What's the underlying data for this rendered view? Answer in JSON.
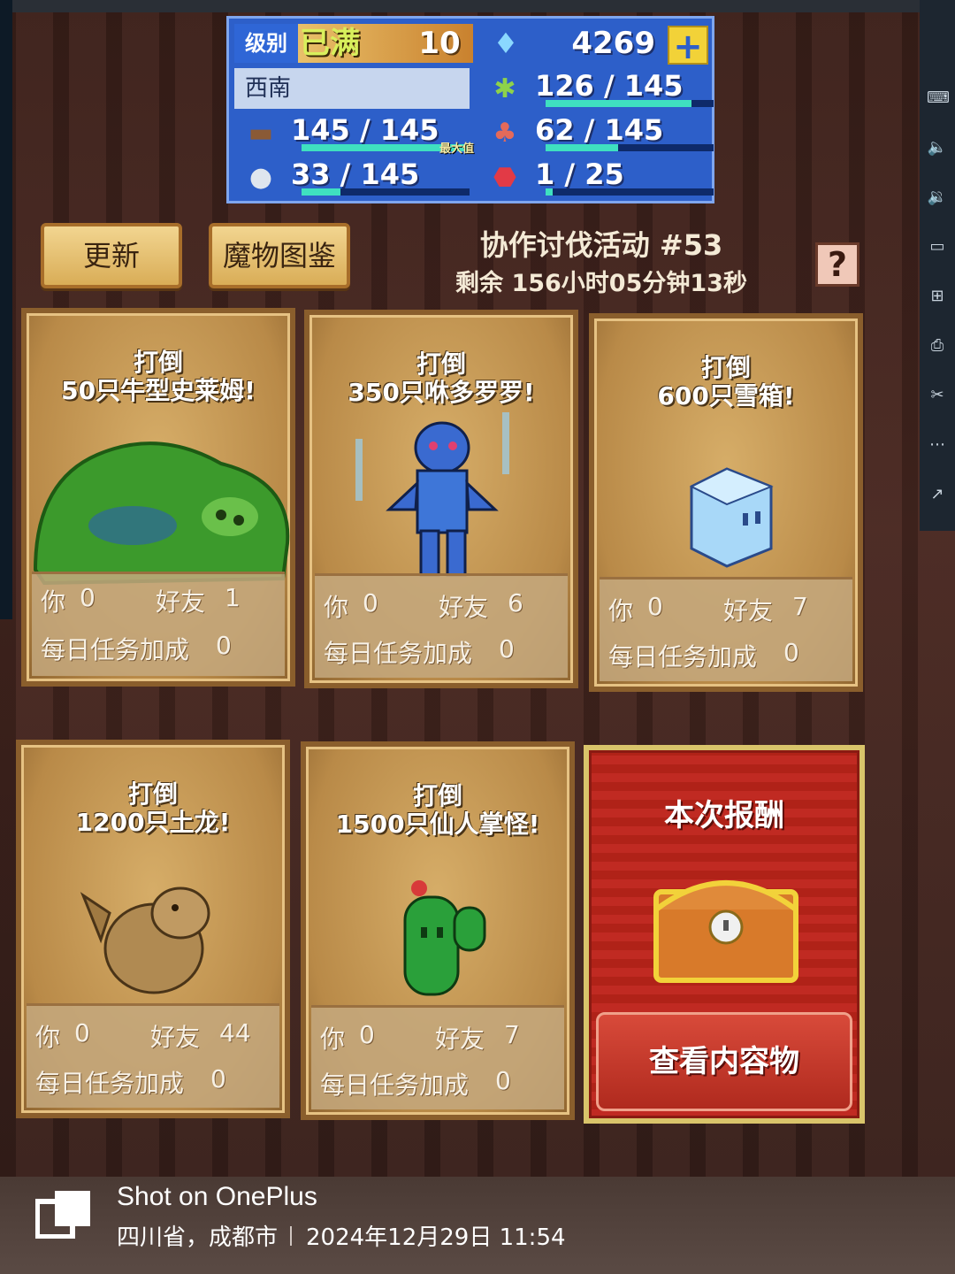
{
  "hud": {
    "level_label": "级别",
    "level_status": "已满",
    "level": "10",
    "gems": "4269",
    "plus": "+",
    "region": "西南",
    "max_tag": "最大值",
    "resources": [
      {
        "icon": "wood-log-icon",
        "value": "145",
        "max": "145",
        "fill": 1.0
      },
      {
        "icon": "stone-icon",
        "value": "33",
        "max": "145",
        "fill": 0.23
      },
      {
        "icon": "grass-food-icon",
        "value": "126",
        "max": "145",
        "fill": 0.87
      },
      {
        "icon": "meat-icon",
        "value": "62",
        "max": "145",
        "fill": 0.43
      },
      {
        "icon": "red-crystal-icon",
        "value": "1",
        "max": "25",
        "fill": 0.04
      }
    ]
  },
  "buttons": {
    "refresh": "更新",
    "monster_guide": "魔物图鉴",
    "help": "?"
  },
  "event": {
    "title": "协作讨伐活动 #53",
    "timer": "剩余 156小时05分钟13秒"
  },
  "stat_labels": {
    "you": "你",
    "friends": "好友",
    "daily_bonus": "每日任务加成"
  },
  "cards": [
    {
      "line1": "打倒",
      "line2": "50只牛型史莱姆!",
      "you": "0",
      "friends": "1",
      "bonus": "0"
    },
    {
      "line1": "打倒",
      "line2": "350只咻多罗罗!",
      "you": "0",
      "friends": "6",
      "bonus": "0"
    },
    {
      "line1": "打倒",
      "line2": "600只雪箱!",
      "you": "0",
      "friends": "7",
      "bonus": "0"
    },
    {
      "line1": "打倒",
      "line2": "1200只土龙!",
      "you": "0",
      "friends": "44",
      "bonus": "0"
    },
    {
      "line1": "打倒",
      "line2": "1500只仙人掌怪!",
      "you": "0",
      "friends": "7",
      "bonus": "0"
    }
  ],
  "reward": {
    "title": "本次报酬",
    "button": "查看内容物"
  },
  "watermark": {
    "title": "Shot on OnePlus",
    "location": "四川省，成都市",
    "datetime": "2024年12月29日 11:54"
  }
}
